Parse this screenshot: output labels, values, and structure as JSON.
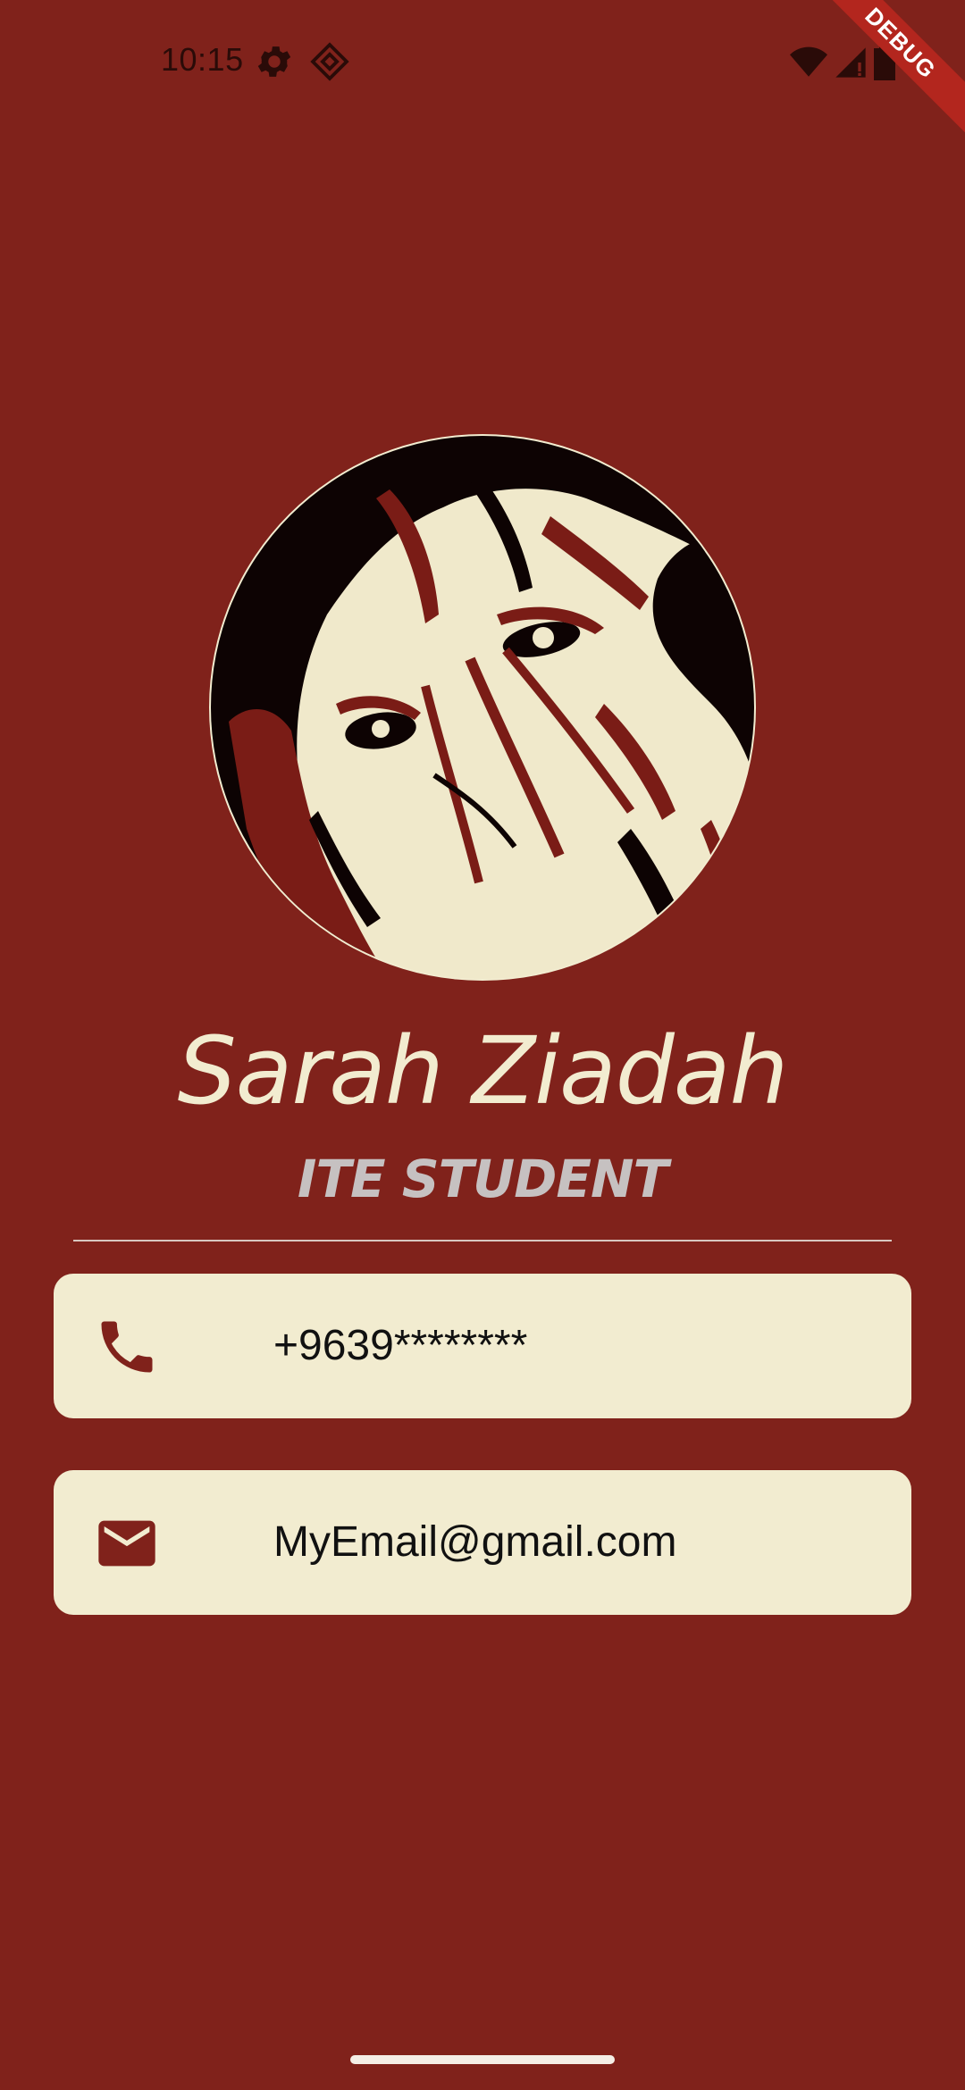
{
  "status_bar": {
    "time": "10:15",
    "icons": [
      "settings-icon",
      "debug-diamond-icon",
      "wifi-icon",
      "signal-icon",
      "battery-icon"
    ]
  },
  "debug_banner": "DEBUG",
  "profile": {
    "name": "Sarah Ziadah",
    "title": "ITE STUDENT",
    "avatar_icon": "profile-photo"
  },
  "contacts": [
    {
      "icon": "phone-icon",
      "value": "+9639********"
    },
    {
      "icon": "email-icon",
      "value": "MyEmail@gmail.com"
    }
  ],
  "colors": {
    "background": "#80221b",
    "card": "#f2ecd0",
    "name": "#f2ecd0",
    "title": "#c6c1c1",
    "icon": "#80221b"
  }
}
